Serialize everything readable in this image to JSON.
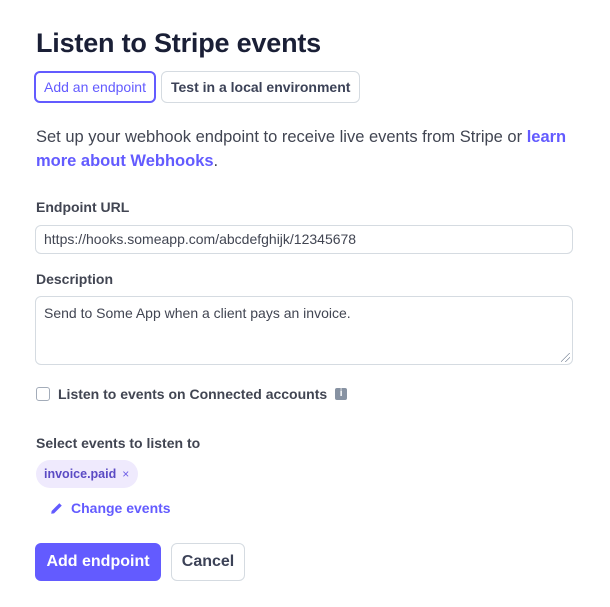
{
  "page": {
    "title": "Listen to Stripe events"
  },
  "tabs": [
    {
      "label": "Add an endpoint",
      "active": true
    },
    {
      "label": "Test in a local environment",
      "active": false
    }
  ],
  "intro": {
    "text_before": "Set up your webhook endpoint to receive live events from Stripe or ",
    "link_text": "learn more about Webhooks",
    "text_after": "."
  },
  "endpoint_url": {
    "label": "Endpoint URL",
    "value": "https://hooks.someapp.com/abcdefghijk/12345678"
  },
  "description": {
    "label": "Description",
    "value": "Send to Some App when a client pays an invoice."
  },
  "connected_accounts": {
    "label": "Listen to events on Connected accounts",
    "checked": false,
    "info_icon": "i"
  },
  "events": {
    "label": "Select events to listen to",
    "selected": [
      {
        "name": "invoice.paid",
        "remove_glyph": "×"
      }
    ],
    "change_label": "Change events"
  },
  "actions": {
    "primary_label": "Add endpoint",
    "secondary_label": "Cancel"
  },
  "colors": {
    "accent": "#635bff",
    "text": "#1a1f36",
    "muted_text": "#414552",
    "border": "#d5dbe1",
    "chip_bg": "#efeafd"
  }
}
